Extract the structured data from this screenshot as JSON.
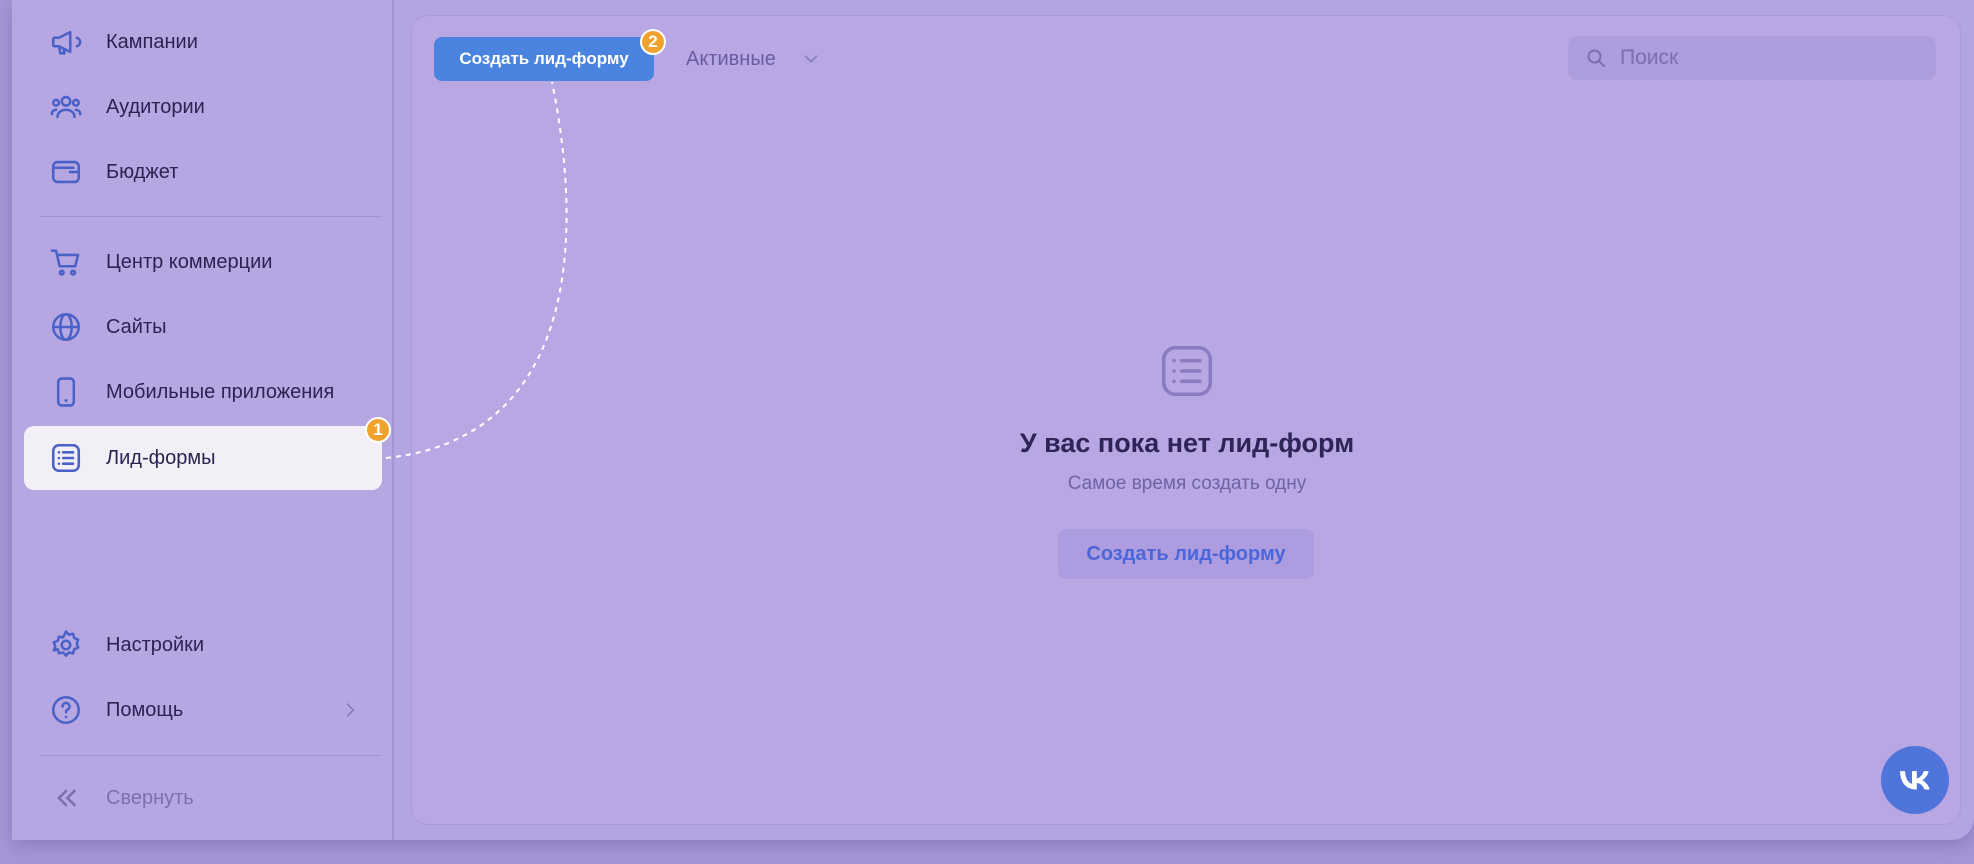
{
  "sidebar": {
    "items": [
      {
        "label": "Кампании",
        "icon": "megaphone-icon"
      },
      {
        "label": "Аудитории",
        "icon": "users-icon"
      },
      {
        "label": "Бюджет",
        "icon": "wallet-icon"
      },
      {
        "label": "Центр коммерции",
        "icon": "cart-icon"
      },
      {
        "label": "Сайты",
        "icon": "globe-icon"
      },
      {
        "label": "Мобильные приложения",
        "icon": "phone-icon"
      },
      {
        "label": "Лид-формы",
        "icon": "list-icon",
        "active": true
      },
      {
        "label": "Настройки",
        "icon": "gear-icon"
      },
      {
        "label": "Помощь",
        "icon": "help-icon"
      },
      {
        "label": "Свернуть",
        "icon": "chevrons-left-icon"
      }
    ]
  },
  "annotations": {
    "step1": "1",
    "step2": "2",
    "badge_color": "#f0a22d"
  },
  "toolbar": {
    "create_button": "Создать лид-форму",
    "filter_value": "Активные",
    "search_placeholder": "Поиск"
  },
  "empty_state": {
    "icon": "list-icon",
    "title": "У вас пока нет лид-форм",
    "subtitle": "Самое время создать одну",
    "button": "Создать лид-форму"
  },
  "vk_button": {
    "icon": "vk-logo-icon"
  },
  "colors": {
    "accent": "#4a84e0",
    "overlay": "#b4a4e1",
    "active_item_bg": "#f2eff7"
  }
}
